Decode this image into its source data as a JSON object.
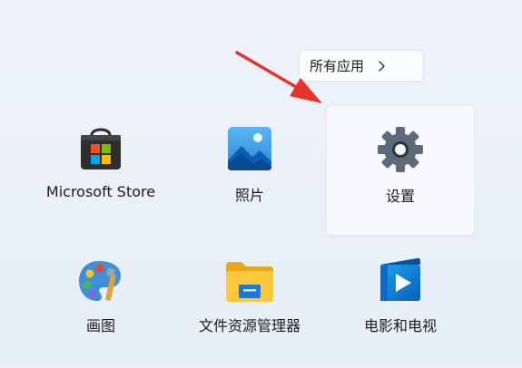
{
  "start_menu": {
    "all_apps": {
      "label": "所有应用",
      "icon": "chevron-right-icon"
    },
    "annotation": {
      "icon": "red-arrow-icon",
      "color": "#e8332a"
    },
    "apps": [
      {
        "label": "Microsoft Store",
        "icon": "microsoft-store-icon"
      },
      {
        "label": "照片",
        "icon": "photos-icon"
      },
      {
        "label": "设置",
        "icon": "settings-gear-icon",
        "selected": true
      },
      {
        "label": "画图",
        "icon": "paint-palette-icon"
      },
      {
        "label": "文件资源管理器",
        "icon": "file-explorer-folder-icon"
      },
      {
        "label": "电影和电视",
        "icon": "movies-tv-play-icon"
      }
    ]
  }
}
